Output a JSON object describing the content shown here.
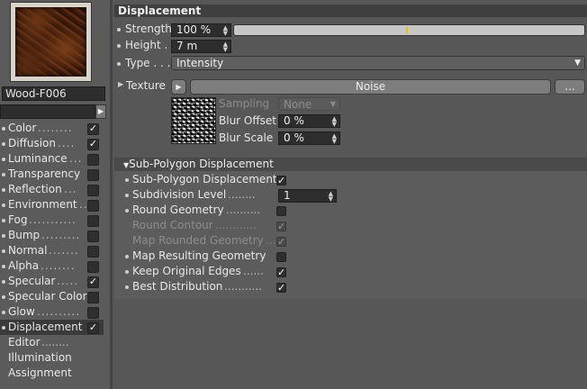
{
  "material": {
    "name": "Wood-F006"
  },
  "channels": [
    {
      "label": "Color",
      "dots": "........",
      "checked": true
    },
    {
      "label": "Diffusion",
      "dots": "....",
      "checked": true
    },
    {
      "label": "Luminance",
      "dots": "...",
      "checked": false
    },
    {
      "label": "Transparency",
      "dots": "",
      "checked": false
    },
    {
      "label": "Reflection",
      "dots": "...",
      "checked": false
    },
    {
      "label": "Environment",
      "dots": "..",
      "checked": false
    },
    {
      "label": "Fog",
      "dots": "...........",
      "checked": false
    },
    {
      "label": "Bump",
      "dots": ".........",
      "checked": false
    },
    {
      "label": "Normal",
      "dots": ".......",
      "checked": false
    },
    {
      "label": "Alpha",
      "dots": "........",
      "checked": false
    },
    {
      "label": "Specular",
      "dots": ".....",
      "checked": true
    },
    {
      "label": "Specular Color",
      "dots": "",
      "checked": false
    },
    {
      "label": "Glow",
      "dots": "..........",
      "checked": false
    },
    {
      "label": "Displacement",
      "dots": "",
      "checked": true
    }
  ],
  "extra_items": [
    "Editor",
    "Illumination",
    "Assignment"
  ],
  "editor_dots": "........",
  "displacement": {
    "title": "Displacement",
    "strength_label": "Strength",
    "strength_value": "100 %",
    "strength_fraction": 1.0,
    "height_label": "Height .",
    "height_value": "7 m",
    "type_label": "Type . . .",
    "type_value": "Intensity",
    "texture_label": "Texture",
    "texture_name": "Noise",
    "more_button": "...",
    "sampling_label": "Sampling",
    "sampling_value": "None",
    "blur_offset_label": "Blur Offset",
    "blur_offset_value": "0 %",
    "blur_scale_label": "Blur Scale",
    "blur_scale_value": "0 %"
  },
  "subpoly": {
    "title": "Sub-Polygon Displacement",
    "rows": [
      {
        "label": "Sub-Polygon Displacement",
        "dots": "",
        "checked": true,
        "disabled": false,
        "dot": true
      },
      {
        "label": "Subdivision Level",
        "dots": "........",
        "value": "1",
        "disabled": false,
        "dot": true
      },
      {
        "label": "Round Geometry",
        "dots": "..........",
        "checked": false,
        "disabled": false,
        "dot": true
      },
      {
        "label": "Round Contour",
        "dots": "............",
        "checked": true,
        "disabled": true,
        "dot": false
      },
      {
        "label": "Map Rounded Geometry",
        "dots": "...",
        "checked": true,
        "disabled": true,
        "dot": false
      },
      {
        "label": "Map Resulting Geometry",
        "dots": "",
        "checked": false,
        "disabled": false,
        "dot": true
      },
      {
        "label": "Keep Original Edges",
        "dots": "......",
        "checked": true,
        "disabled": false,
        "dot": true
      },
      {
        "label": "Best Distribution",
        "dots": "...........",
        "checked": true,
        "disabled": false,
        "dot": true
      }
    ]
  },
  "colors": {
    "strength_marker": "#e8c400",
    "panel": "#575757",
    "field": "#2d2d2d"
  },
  "icons": {
    "check": "checkmark-icon",
    "spinner": "spinner-arrows-icon",
    "dropdown": "triangle-down-icon"
  }
}
